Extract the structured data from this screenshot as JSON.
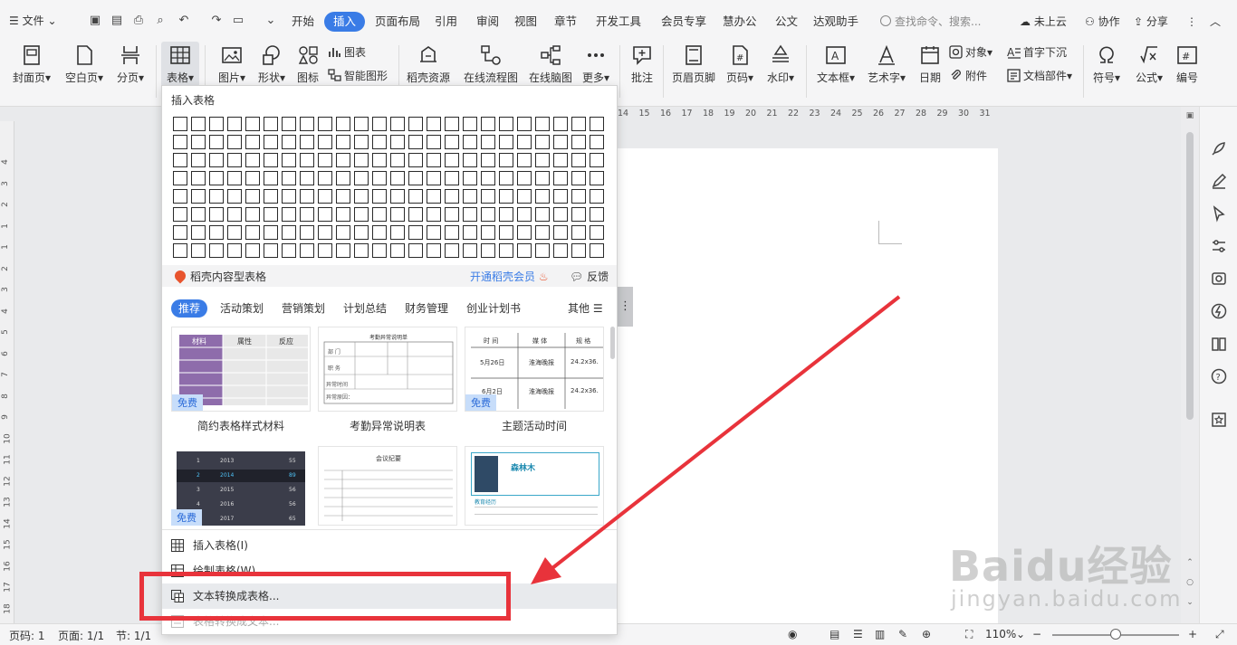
{
  "topbar": {
    "file_menu": "文件",
    "tabs": [
      "开始",
      "插入",
      "页面布局",
      "引用",
      "审阅",
      "视图",
      "章节",
      "开发工具",
      "会员专享",
      "慧办公",
      "公文",
      "达观助手"
    ],
    "active_tab": "插入",
    "search_placeholder": "查找命令、搜索...",
    "cloud": "未上云",
    "collab": "协作",
    "share": "分享"
  },
  "ribbon": {
    "cover": "封面页",
    "blank": "空白页",
    "page_break": "分页",
    "table": "表格",
    "picture": "图片",
    "shape": "形状",
    "icon": "图标",
    "chart": "图表",
    "smart_shape": "智能图形",
    "docer": "稻壳资源",
    "flowchart": "在线流程图",
    "mindmap": "在线脑图",
    "more": "更多",
    "comment": "批注",
    "header_footer": "页眉页脚",
    "page_num": "页码",
    "watermark": "水印",
    "textbox": "文本框",
    "wordart": "艺术字",
    "date": "日期",
    "object": "对象",
    "attachment": "附件",
    "dropcap": "首字下沉",
    "doc_parts": "文档部件",
    "symbol": "符号",
    "formula": "公式",
    "numbering": "编号"
  },
  "dropdown": {
    "title": "插入表格",
    "promo_label": "稻壳内容型表格",
    "vip_link": "开通稻壳会员",
    "feedback": "反馈",
    "categories": [
      "推荐",
      "活动策划",
      "营销策划",
      "计划总结",
      "财务管理",
      "创业计划书"
    ],
    "categories_more": "其他",
    "free_badge": "免费",
    "templates": [
      {
        "title": "简约表格样式材料"
      },
      {
        "title": "考勤异常说明表"
      },
      {
        "title": "主题活动时间"
      }
    ],
    "tpl1": {
      "h1": "材料",
      "h2": "属性",
      "h3": "反应"
    },
    "tpl2": {
      "heading": "考勤异常说明单",
      "r1": "部 门",
      "r2": "职 务",
      "r3": "异常时间",
      "r4": "异常原因："
    },
    "tpl3": {
      "h1": "时 间",
      "h2": "媒 体",
      "h3": "规 格",
      "r1a": "5月26日",
      "r1b": "淮海晚报",
      "r1c": "24.2x36.",
      "r2a": "6月2日",
      "r2b": "淮海晚报",
      "r2c": "24.2x36."
    },
    "tpl4": {
      "rows": [
        [
          "1",
          "2013",
          "55"
        ],
        [
          "2",
          "2014",
          "89"
        ],
        [
          "3",
          "2015",
          "56"
        ],
        [
          "4",
          "2016",
          "56"
        ],
        [
          "5",
          "2017",
          "65"
        ]
      ]
    },
    "tpl5": {
      "heading": "会议纪要"
    },
    "tpl6": {
      "name": "森林木",
      "edu": "教育经历"
    },
    "menu": {
      "insert_table": "插入表格(I)",
      "draw_table": "绘制表格(W)",
      "text_to_table": "文本转换成表格...",
      "table_to_text": "表格转换成文本..."
    }
  },
  "ruler_top": [
    "14",
    "15",
    "16",
    "17",
    "18",
    "19",
    "20",
    "21",
    "22",
    "23",
    "24",
    "25",
    "26",
    "27",
    "28",
    "29",
    "30",
    "31"
  ],
  "ruler_left": [
    "4",
    "3",
    "2",
    "1",
    "1",
    "2",
    "3",
    "4",
    "5",
    "6",
    "7",
    "8",
    "9",
    "10",
    "11",
    "12",
    "13",
    "14",
    "15",
    "16",
    "17",
    "18"
  ],
  "statusbar": {
    "page_num": "页码: 1",
    "pages": "页面: 1/1",
    "section": "节: 1/1",
    "zoom": "110%"
  },
  "watermark_text": "Baidu经验",
  "watermark_sub": "jingyan.baidu.com",
  "colors": {
    "accent": "#3a7ce6",
    "annotation_red": "#e8333b"
  }
}
